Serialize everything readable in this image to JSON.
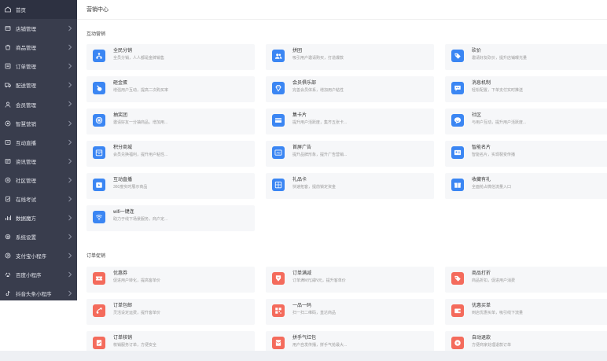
{
  "sidebar": {
    "items": [
      {
        "label": "首页",
        "icon": "home-icon"
      },
      {
        "label": "店铺管理",
        "icon": "shop-icon"
      },
      {
        "label": "商品管理",
        "icon": "goods-icon"
      },
      {
        "label": "订单管理",
        "icon": "order-icon"
      },
      {
        "label": "配送管理",
        "icon": "delivery-icon"
      },
      {
        "label": "会员管理",
        "icon": "member-icon"
      },
      {
        "label": "智慧营销",
        "icon": "marketing-icon"
      },
      {
        "label": "互动直播",
        "icon": "live-icon"
      },
      {
        "label": "资讯管理",
        "icon": "news-icon"
      },
      {
        "label": "社区管理",
        "icon": "community-icon"
      },
      {
        "label": "在线考试",
        "icon": "exam-icon"
      },
      {
        "label": "数据魔方",
        "icon": "data-icon"
      },
      {
        "label": "系统设置",
        "icon": "settings-icon"
      },
      {
        "label": "支付宝小程序",
        "icon": "alipay-icon"
      },
      {
        "label": "百度小程序",
        "icon": "baidu-icon"
      },
      {
        "label": "抖音头条小程序",
        "icon": "douyin-icon"
      }
    ]
  },
  "header": {
    "title": "营销中心"
  },
  "sections": [
    {
      "title": "互动营销",
      "cards": [
        {
          "title": "全民分销",
          "desc": "全员分销，人人都是金牌销售",
          "icon": "distribution-icon",
          "color": "#3b86f3"
        },
        {
          "title": "拼团",
          "desc": "吸引用户邀请购买，打造爆款",
          "icon": "group-buy-icon",
          "color": "#3b86f3"
        },
        {
          "title": "砍价",
          "desc": "邀请好友砍价，提升店铺曝光量",
          "icon": "bargain-icon",
          "color": "#3b86f3"
        },
        {
          "title": "砸金蛋",
          "desc": "增强用户互动，提高二次购买率",
          "icon": "golden-egg-icon",
          "color": "#3b86f3"
        },
        {
          "title": "会员俱乐部",
          "desc": "完善会员体系，增加用户粘性",
          "icon": "diamond-icon",
          "color": "#3b86f3"
        },
        {
          "title": "消息机制",
          "desc": "轻松配置，下单支付实时推送",
          "icon": "message-icon",
          "color": "#3b86f3"
        },
        {
          "title": "抽奖团",
          "desc": "邀请好友一分抽商品，增加用...",
          "icon": "lottery-icon",
          "color": "#3b86f3"
        },
        {
          "title": "集卡片",
          "desc": "提升用户活跃度，集齐五张卡...",
          "icon": "card-collect-icon",
          "color": "#3b86f3"
        },
        {
          "title": "社区",
          "desc": "与用户互动，提升用户活跃度...",
          "icon": "community-chat-icon",
          "color": "#3b86f3"
        },
        {
          "title": "积分商城",
          "desc": "会员兑换福利，提升用户粘性...",
          "icon": "points-mall-icon",
          "color": "#3b86f3"
        },
        {
          "title": "首屏广告",
          "desc": "提升品牌形象，提升广告营销...",
          "icon": "ad-icon",
          "color": "#3b86f3"
        },
        {
          "title": "智能名片",
          "desc": "智能名片，实现裂变传播",
          "icon": "business-card-icon",
          "color": "#3b86f3"
        },
        {
          "title": "互动直播",
          "desc": "360度实时展示商品",
          "icon": "live-stream-icon",
          "color": "#3b86f3"
        },
        {
          "title": "礼品卡",
          "desc": "快速拓客，提前锁定资金",
          "icon": "gift-card-icon",
          "color": "#3b86f3"
        },
        {
          "title": "收藏有礼",
          "desc": "全面抢占微信流量入口",
          "icon": "gift-icon",
          "color": "#3b86f3"
        },
        {
          "title": "wifi一键连",
          "desc": "助力于线下场景服务，商户定...",
          "icon": "wifi-icon",
          "color": "#3b86f3"
        }
      ]
    },
    {
      "title": "订单促销",
      "cards": [
        {
          "title": "优惠券",
          "desc": "促进用户转化，提高客单价",
          "icon": "coupon-icon",
          "color": "#f46b5c"
        },
        {
          "title": "订单满减",
          "desc": "订单满M元减N元，提升客单价",
          "icon": "full-reduce-icon",
          "color": "#f46b5c"
        },
        {
          "title": "商品打折",
          "desc": "商品折扣，促进用户消费",
          "icon": "discount-icon",
          "color": "#f46b5c"
        },
        {
          "title": "订单包邮",
          "desc": "灵活设定运费，提升客单价",
          "icon": "free-shipping-icon",
          "color": "#f46b5c"
        },
        {
          "title": "一品一码",
          "desc": "扫一扫二维码，直达商品",
          "icon": "qrcode-icon",
          "color": "#f46b5c"
        },
        {
          "title": "优惠买单",
          "desc": "到店优惠买单，吸引线下流量",
          "icon": "pay-bill-icon",
          "color": "#f46b5c"
        },
        {
          "title": "订单核销",
          "desc": "核销服务订单，方便安全",
          "icon": "verify-icon",
          "color": "#f46b5c"
        },
        {
          "title": "拼手气红包",
          "desc": "用户自发传播，拼手气抢最大...",
          "icon": "red-packet-icon",
          "color": "#f46b5c"
        },
        {
          "title": "自动退款",
          "desc": "方便商家处理退款订单",
          "icon": "refund-icon",
          "color": "#f46b5c"
        }
      ]
    }
  ]
}
